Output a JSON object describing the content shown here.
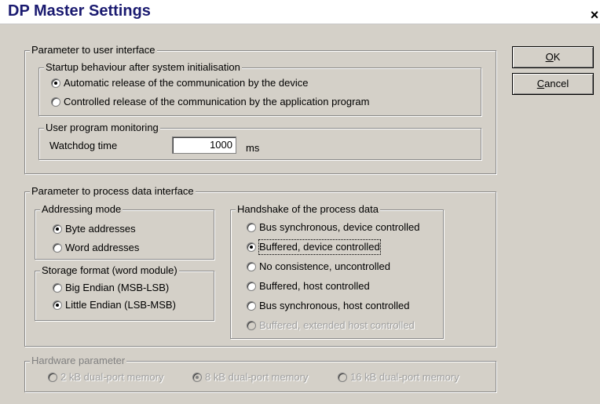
{
  "window": {
    "title": "DP Master Settings",
    "close_glyph": "×"
  },
  "buttons": {
    "ok_mnemonic": "O",
    "ok_rest": "K",
    "cancel_mnemonic": "C",
    "cancel_rest": "ancel"
  },
  "user_interface": {
    "legend": "Parameter to user interface",
    "startup": {
      "legend": "Startup behaviour after system initialisation",
      "options": [
        {
          "label": "Automatic release of the communication by the device",
          "checked": true
        },
        {
          "label": "Controlled release of the communication by the application program",
          "checked": false
        }
      ]
    },
    "monitoring": {
      "legend": "User program monitoring",
      "watchdog_label": "Watchdog time",
      "watchdog_value": "1000",
      "watchdog_unit": "ms"
    }
  },
  "process_data": {
    "legend": "Parameter to process data interface",
    "addressing": {
      "legend": "Addressing mode",
      "options": [
        {
          "label": "Byte addresses",
          "checked": true
        },
        {
          "label": "Word addresses",
          "checked": false
        }
      ]
    },
    "storage": {
      "legend": "Storage format (word module)",
      "options": [
        {
          "label": "Big Endian (MSB-LSB)",
          "checked": false
        },
        {
          "label": "Little Endian (LSB-MSB)",
          "checked": true
        }
      ]
    },
    "handshake": {
      "legend": "Handshake of the process data",
      "options": [
        {
          "label": "Bus synchronous, device controlled",
          "checked": false,
          "enabled": true
        },
        {
          "label": "Buffered, device controlled",
          "checked": true,
          "enabled": true
        },
        {
          "label": "No consistence, uncontrolled",
          "checked": false,
          "enabled": true
        },
        {
          "label": "Buffered, host controlled",
          "checked": false,
          "enabled": true
        },
        {
          "label": "Bus synchronous, host controlled",
          "checked": false,
          "enabled": true
        },
        {
          "label": "Buffered, extended host controlled",
          "checked": false,
          "enabled": false
        }
      ]
    }
  },
  "hardware": {
    "legend": "Hardware parameter",
    "options": [
      {
        "label": "2 kB dual-port memory",
        "checked": false
      },
      {
        "label": "8 kB dual-port memory",
        "checked": true
      },
      {
        "label": "16 kB dual-port memory",
        "checked": false
      }
    ]
  }
}
